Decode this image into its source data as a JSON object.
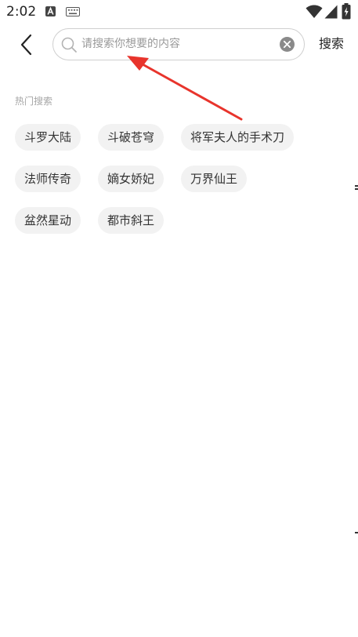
{
  "status_bar": {
    "time": "2:02",
    "icons": [
      "a-notification-icon",
      "keyboard-icon",
      "wifi-icon",
      "signal-icon",
      "battery-icon"
    ]
  },
  "search": {
    "placeholder": "请搜索你想要的内容",
    "value": "",
    "submit_label": "搜索"
  },
  "hot": {
    "label": "热门搜索",
    "rows": [
      [
        "斗罗大陆",
        "斗破苍穹",
        "将军夫人的手术刀"
      ],
      [
        "法师传奇",
        "嫡女娇妃",
        "万界仙王"
      ],
      [
        "盆然星动",
        "都市斜王"
      ]
    ]
  },
  "colors": {
    "annotation_arrow": "#e8342c",
    "tag_background": "#f2f2f2",
    "search_border": "#cfcfcf",
    "label_gray": "#a6a6a6"
  }
}
